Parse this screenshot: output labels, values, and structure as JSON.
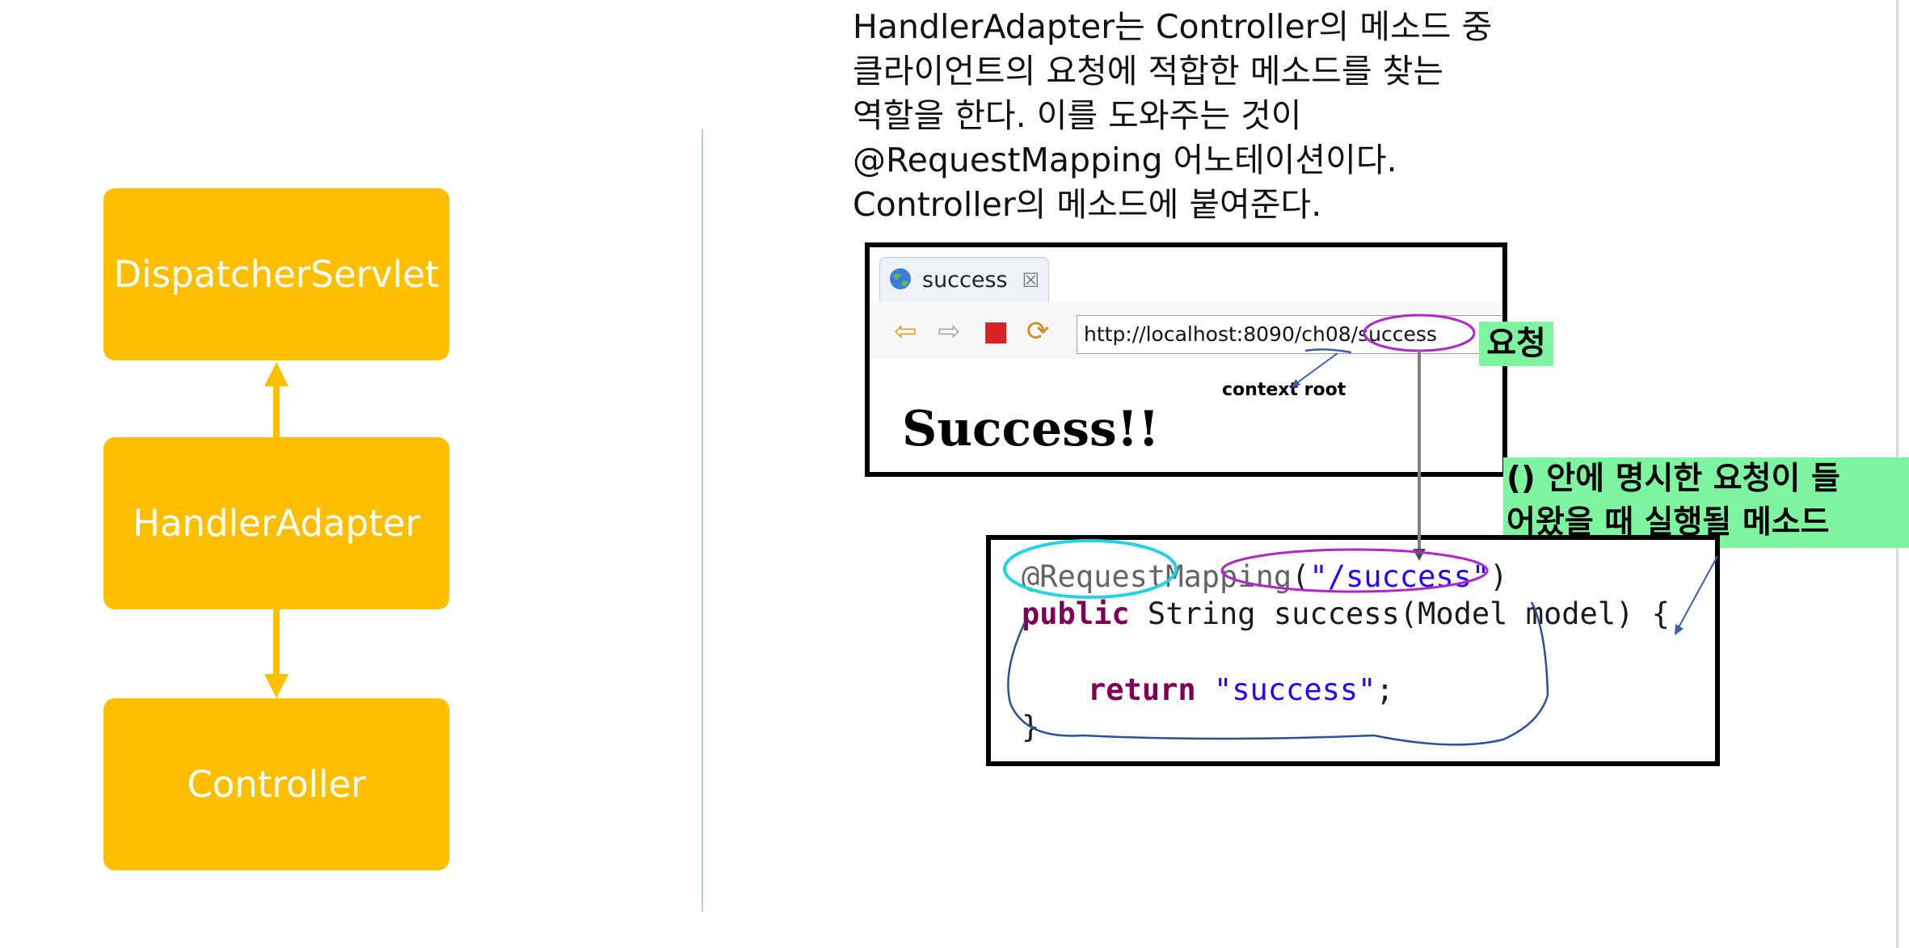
{
  "flow": {
    "dispatcher": "DispatcherServlet",
    "handler": "HandlerAdapter",
    "controller": "Controller"
  },
  "description": {
    "lines": [
      "HandlerAdapter는 Controller의 메소드 중",
      "클라이언트의 요청에 적합한 메소드를 찾는",
      "역할을 한다. 이를 도와주는 것이",
      "@RequestMapping 어노테이션이다.",
      "Controller의 메소드에 붙여준다."
    ]
  },
  "browser": {
    "tab_title": "success",
    "url": "http://localhost:8090/ch08/success",
    "page_text": "Success!!",
    "context_root_label": "context root"
  },
  "labels": {
    "request": "요청",
    "explain_lines": [
      "() 안에 명시한 요청이 들",
      "어왔을 때 실행될 메소드"
    ]
  },
  "code": {
    "annotation": "@RequestMapping",
    "paren_open": "(",
    "mapping_value": "\"/success\"",
    "paren_close": ")",
    "line2_keyword": "public",
    "line2_rest": " String success(Model model) {",
    "return_keyword": "return",
    "return_value": "\"success\"",
    "return_end": ";",
    "close_brace": "}"
  },
  "colors": {
    "flow_box": "#FDBF00",
    "highlight_green": "#7ef3a0",
    "annotation_circle": "#22d3e6",
    "url_circle": "#b026c9",
    "method_outline": "#2b4f9e",
    "divider": "#b8cbe3"
  }
}
